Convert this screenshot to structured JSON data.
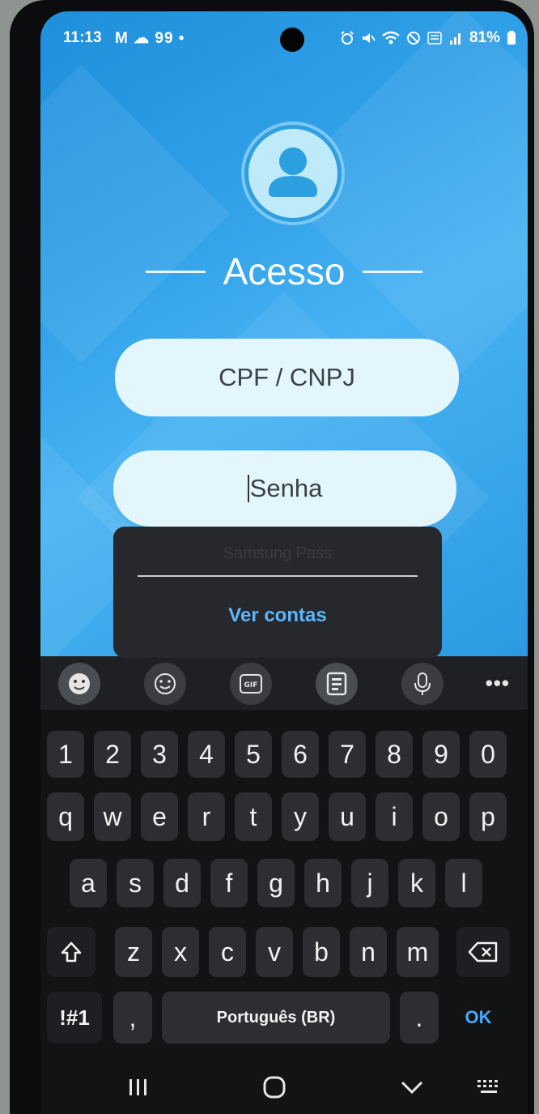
{
  "status_bar": {
    "time": "11:13",
    "notification_text": "M ☁ 99 •",
    "battery": "81%"
  },
  "login": {
    "title": "Acesso",
    "cpf_placeholder": "CPF / CNPJ",
    "password_placeholder": "Senha"
  },
  "autofill_popup": {
    "hint": "Samsung Pass",
    "action_label": "Ver contas"
  },
  "keyboard": {
    "number_row": [
      "1",
      "2",
      "3",
      "4",
      "5",
      "6",
      "7",
      "8",
      "9",
      "0"
    ],
    "row1": [
      "q",
      "w",
      "e",
      "r",
      "t",
      "y",
      "u",
      "i",
      "o",
      "p"
    ],
    "row2": [
      "a",
      "s",
      "d",
      "f",
      "g",
      "h",
      "j",
      "k",
      "l"
    ],
    "row3": [
      "z",
      "x",
      "c",
      "v",
      "b",
      "n",
      "m"
    ],
    "symbols_label": "!#1",
    "comma": ",",
    "space_label": "Português (BR)",
    "period": ".",
    "enter_label": "OK"
  },
  "colors": {
    "app_background": "#2f9fe7",
    "field_background": "#e3f6fb",
    "keyboard_background": "#121315",
    "accent_link": "#5bb6ff"
  }
}
